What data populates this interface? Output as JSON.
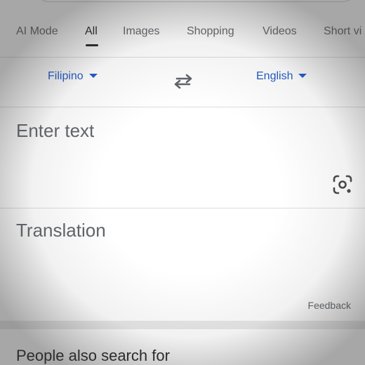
{
  "tabs": [
    {
      "label": "AI Mode"
    },
    {
      "label": "All"
    },
    {
      "label": "Images"
    },
    {
      "label": "Shopping"
    },
    {
      "label": "Videos"
    },
    {
      "label": "Short vi"
    }
  ],
  "translator": {
    "source_language": "Filipino",
    "target_language": "English",
    "input_placeholder": "Enter text",
    "output_placeholder": "Translation",
    "feedback_label": "Feedback"
  },
  "section": {
    "people_also_search_for": "People also search for"
  },
  "colors": {
    "accent": "#1a56c8",
    "text_primary": "#202124",
    "text_secondary": "#5f6368"
  },
  "icons": {
    "swap": "swap-languages-icon",
    "camera": "camera-lens-icon",
    "caret": "dropdown-caret-icon"
  }
}
